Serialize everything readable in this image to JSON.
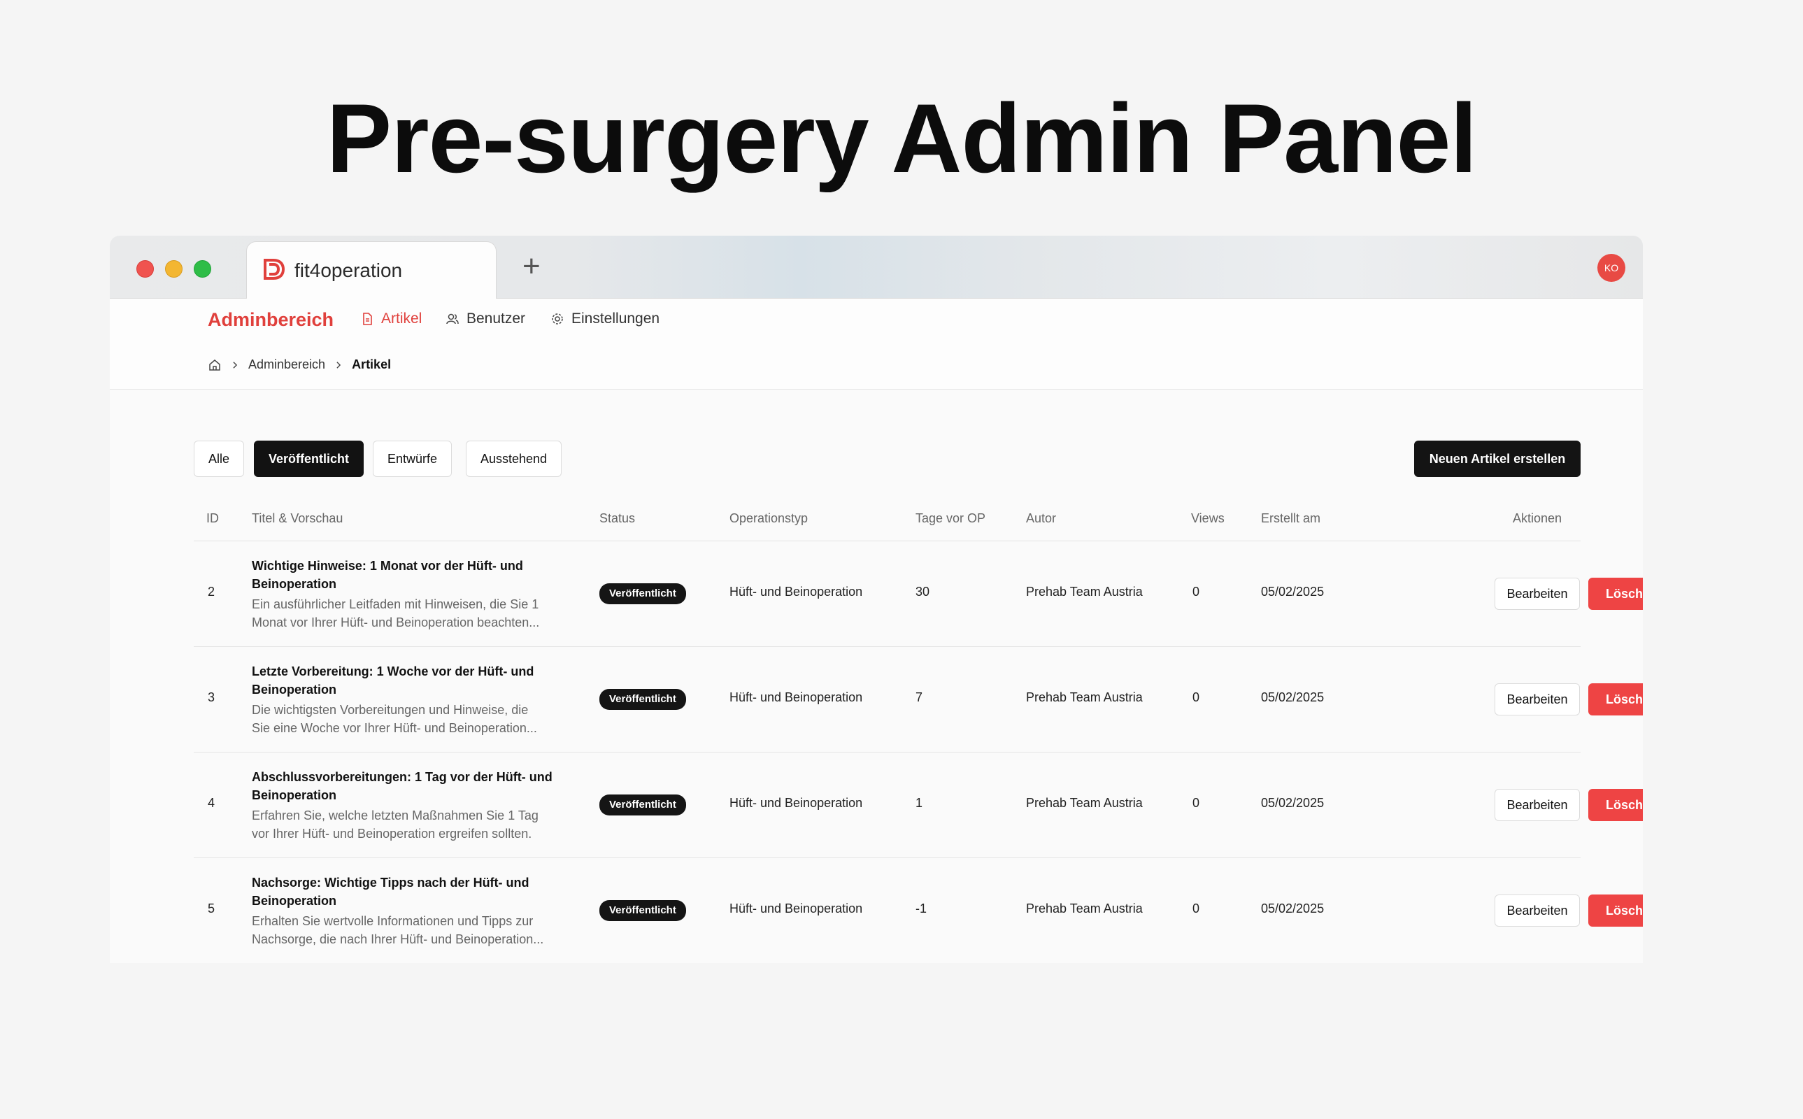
{
  "hero": {
    "title": "Pre-surgery Admin Panel"
  },
  "browser": {
    "tab_title": "fit4operation",
    "new_tab_symbol": "+",
    "avatar_initials": "KO"
  },
  "nav": {
    "brand": "Adminbereich",
    "items": [
      {
        "label": "Artikel",
        "icon": "document-icon",
        "active": true
      },
      {
        "label": "Benutzer",
        "icon": "users-icon",
        "active": false
      },
      {
        "label": "Einstellungen",
        "icon": "gear-icon",
        "active": false
      }
    ]
  },
  "breadcrumb": {
    "home_icon": "home-icon",
    "level1": "Adminbereich",
    "current": "Artikel"
  },
  "filters": [
    "Alle",
    "Veröffentlicht",
    "Entwürfe",
    "Ausstehend"
  ],
  "active_filter": "Veröffentlicht",
  "create_button": "Neuen Artikel erstellen",
  "table": {
    "headers": {
      "id": "ID",
      "title": "Titel & Vorschau",
      "status": "Status",
      "optype": "Operationstyp",
      "days": "Tage vor OP",
      "author": "Autor",
      "views": "Views",
      "created": "Erstellt am",
      "actions": "Aktionen"
    },
    "rows": [
      {
        "id": "2",
        "title_line1": "Wichtige Hinweise: 1 Monat vor der Hüft- und",
        "title_line2": "Beinoperation",
        "preview_line1": "Ein ausführlicher Leitfaden mit Hinweisen, die Sie 1",
        "preview_line2": "Monat vor Ihrer Hüft- und Beinoperation beachten...",
        "status": "Veröffentlicht",
        "optype": "Hüft- und Beinoperation",
        "days": "30",
        "author": "Prehab Team Austria",
        "views": "0",
        "created": "05/02/2025",
        "edit": "Bearbeiten",
        "delete": "Löschen"
      },
      {
        "id": "3",
        "title_line1": "Letzte Vorbereitung: 1 Woche vor der Hüft- und",
        "title_line2": "Beinoperation",
        "preview_line1": "Die wichtigsten Vorbereitungen und Hinweise, die",
        "preview_line2": "Sie eine Woche vor Ihrer Hüft- und Beinoperation...",
        "status": "Veröffentlicht",
        "optype": "Hüft- und Beinoperation",
        "days": "7",
        "author": "Prehab Team Austria",
        "views": "0",
        "created": "05/02/2025",
        "edit": "Bearbeiten",
        "delete": "Löschen"
      },
      {
        "id": "4",
        "title_line1": "Abschlussvorbereitungen: 1 Tag vor der Hüft- und",
        "title_line2": "Beinoperation",
        "preview_line1": "Erfahren Sie, welche letzten Maßnahmen Sie 1 Tag",
        "preview_line2": "vor Ihrer Hüft- und Beinoperation ergreifen sollten.",
        "status": "Veröffentlicht",
        "optype": "Hüft- und Beinoperation",
        "days": "1",
        "author": "Prehab Team Austria",
        "views": "0",
        "created": "05/02/2025",
        "edit": "Bearbeiten",
        "delete": "Löschen"
      },
      {
        "id": "5",
        "title_line1": "Nachsorge: Wichtige Tipps nach der Hüft- und",
        "title_line2": "Beinoperation",
        "preview_line1": "Erhalten Sie wertvolle Informationen und Tipps zur",
        "preview_line2": "Nachsorge, die nach Ihrer Hüft- und Beinoperation...",
        "status": "Veröffentlicht",
        "optype": "Hüft- und Beinoperation",
        "days": "-1",
        "author": "Prehab Team Austria",
        "views": "0",
        "created": "05/02/2025",
        "edit": "Bearbeiten",
        "delete": "Löschen"
      }
    ]
  },
  "colors": {
    "accent": "#e0403c",
    "danger": "#ee4444",
    "dark": "#141414"
  }
}
